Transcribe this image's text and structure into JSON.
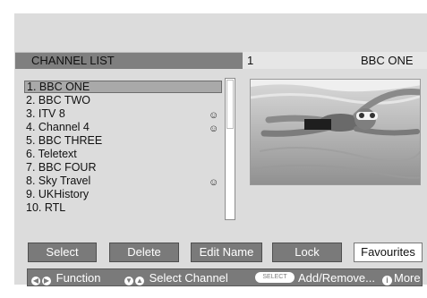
{
  "header": {
    "title": "CHANNEL LIST",
    "channel_number": "1",
    "channel_name": "BBC ONE"
  },
  "channels": [
    {
      "label": "1. BBC ONE",
      "selected": true,
      "favourite": false
    },
    {
      "label": "2. BBC TWO",
      "selected": false,
      "favourite": false
    },
    {
      "label": "3. ITV 8",
      "selected": false,
      "favourite": true
    },
    {
      "label": "4. Channel 4",
      "selected": false,
      "favourite": true
    },
    {
      "label": "5. BBC THREE",
      "selected": false,
      "favourite": false
    },
    {
      "label": "6. Teletext",
      "selected": false,
      "favourite": false
    },
    {
      "label": "7. BBC FOUR",
      "selected": false,
      "favourite": false
    },
    {
      "label": "8. Sky Travel",
      "selected": false,
      "favourite": true
    },
    {
      "label": "9. UKHistory",
      "selected": false,
      "favourite": false
    },
    {
      "label": "10. RTL",
      "selected": false,
      "favourite": false
    }
  ],
  "favourite_icon": "smiley-icon",
  "buttons": {
    "select": "Select",
    "delete": "Delete",
    "edit_name": "Edit Name",
    "lock": "Lock",
    "favourites": "Favourites"
  },
  "hints": {
    "function": "Function",
    "select_channel": "Select Channel",
    "select_key": "SELECT",
    "add_remove": "Add/Remove...",
    "more": "More"
  },
  "colors": {
    "panel": "#dcdcdc",
    "header": "#7f7f7f",
    "button": "#7a7a7a",
    "selected_row": "#a9a9a9"
  }
}
